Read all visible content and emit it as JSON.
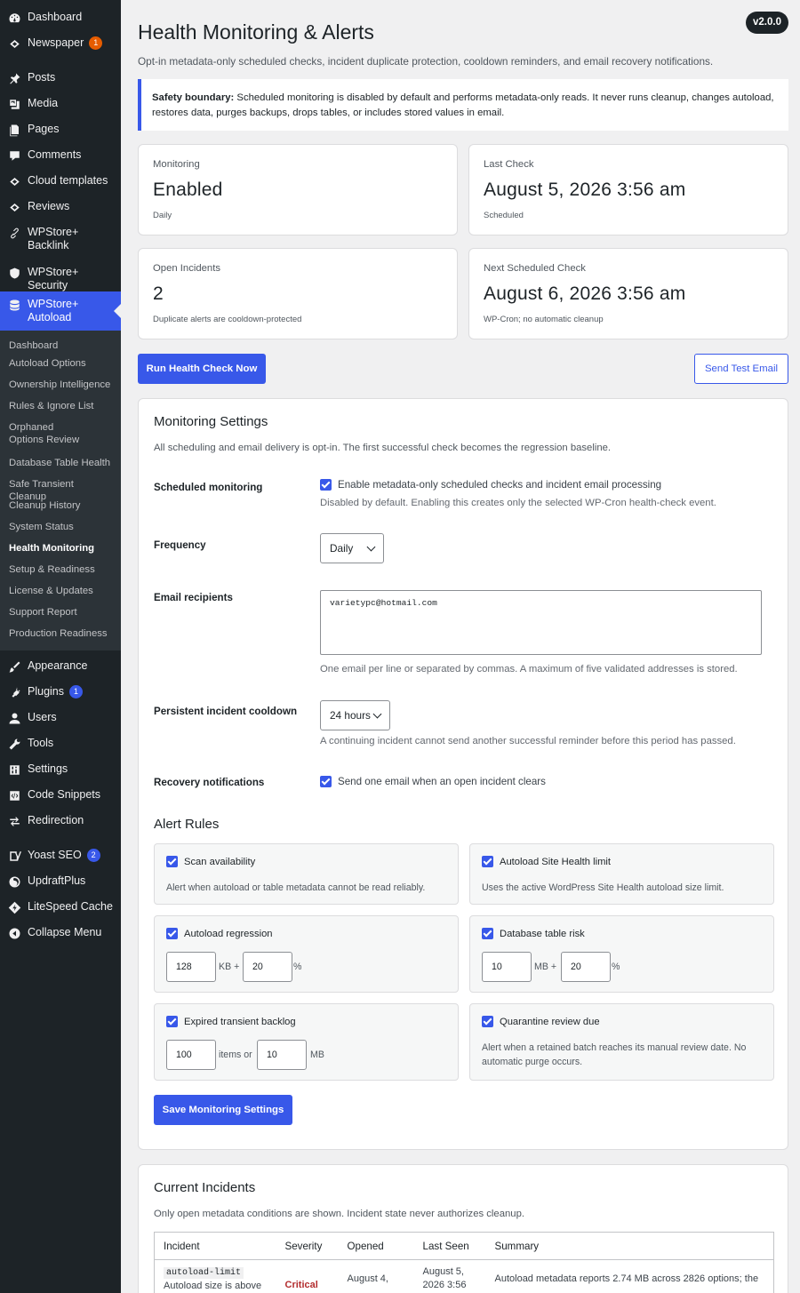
{
  "sidebar": {
    "top": [
      {
        "label": "Dashboard",
        "icon": "dashboard-icon"
      },
      {
        "label": "Newspaper",
        "icon": "newspaper-icon",
        "badge": "1"
      }
    ],
    "main": [
      {
        "label": "Posts",
        "icon": "pin-icon"
      },
      {
        "label": "Media",
        "icon": "media-icon"
      },
      {
        "label": "Pages",
        "icon": "pages-icon"
      },
      {
        "label": "Comments",
        "icon": "comment-icon"
      },
      {
        "label": "Cloud templates",
        "icon": "diamond-icon"
      },
      {
        "label": "Reviews",
        "icon": "diamond-icon"
      },
      {
        "label": "WPStore+ Backlink",
        "icon": "link-icon"
      },
      {
        "label": "WPStore+ Security",
        "icon": "shield-icon"
      },
      {
        "label": "WPStore+ Autoload",
        "icon": "database-icon"
      }
    ],
    "submenu": [
      "Dashboard",
      "Autoload Options",
      "Ownership Intelligence",
      "Rules & Ignore List",
      "Orphaned Options Review",
      "Database Table Health",
      "Safe Transient Cleanup",
      "Cleanup History",
      "System Status",
      "Health Monitoring",
      "Setup & Readiness",
      "License & Updates",
      "Support Report",
      "Production Readiness"
    ],
    "bottom": [
      {
        "label": "Appearance",
        "icon": "brush-icon"
      },
      {
        "label": "Plugins",
        "icon": "plug-icon",
        "badge": "1"
      },
      {
        "label": "Users",
        "icon": "user-icon"
      },
      {
        "label": "Tools",
        "icon": "wrench-icon"
      },
      {
        "label": "Settings",
        "icon": "settings-icon"
      },
      {
        "label": "Code Snippets",
        "icon": "code-icon"
      },
      {
        "label": "Redirection",
        "icon": "redirect-icon"
      }
    ],
    "extra": [
      {
        "label": "Yoast SEO",
        "icon": "yoast-icon",
        "badge": "2"
      },
      {
        "label": "UpdraftPlus",
        "icon": "updraft-icon"
      },
      {
        "label": "LiteSpeed Cache",
        "icon": "litespeed-icon"
      },
      {
        "label": "Collapse Menu",
        "icon": "collapse-icon"
      }
    ]
  },
  "header": {
    "title": "Health Monitoring & Alerts",
    "subtitle": "Opt-in metadata-only scheduled checks, incident duplicate protection, cooldown reminders, and email recovery notifications.",
    "version": "v2.0.0"
  },
  "notice": {
    "strong": "Safety boundary:",
    "text": " Scheduled monitoring is disabled by default and performs metadata-only reads. It never runs cleanup, changes autoload, restores data, purges backups, drops tables, or includes stored values in email."
  },
  "cards": [
    {
      "label": "Monitoring",
      "value": "Enabled",
      "note": "Daily"
    },
    {
      "label": "Last Check",
      "value": "August 5, 2026 3:56 am",
      "note": "Scheduled"
    },
    {
      "label": "Open Incidents",
      "value": "2",
      "note": "Duplicate alerts are cooldown-protected"
    },
    {
      "label": "Next Scheduled Check",
      "value": "August 6, 2026 3:56 am",
      "note": "WP-Cron; no automatic cleanup"
    }
  ],
  "actions": {
    "run": "Run Health Check Now",
    "test": "Send Test Email"
  },
  "settings": {
    "title": "Monitoring Settings",
    "desc": "All scheduling and email delivery is opt-in. The first successful check becomes the regression baseline.",
    "scheduled": {
      "label": "Scheduled monitoring",
      "check": "Enable metadata-only scheduled checks and incident email processing",
      "hint": "Disabled by default. Enabling this creates only the selected WP-Cron health-check event."
    },
    "frequency": {
      "label": "Frequency",
      "value": "Daily"
    },
    "email": {
      "label": "Email recipients",
      "value": "varietypc@hotmail.com",
      "hint": "One email per line or separated by commas. A maximum of five validated addresses is stored."
    },
    "cooldown": {
      "label": "Persistent incident cooldown",
      "value": "24 hours",
      "hint": "A continuing incident cannot send another successful reminder before this period has passed."
    },
    "recovery": {
      "label": "Recovery notifications",
      "check": "Send one email when an open incident clears"
    }
  },
  "alert_rules": {
    "title": "Alert Rules",
    "scan": {
      "label": "Scan availability",
      "desc": "Alert when autoload or table metadata cannot be read reliably."
    },
    "site_health": {
      "label": "Autoload Site Health limit",
      "desc": "Uses the active WordPress Site Health autoload size limit."
    },
    "regression": {
      "label": "Autoload regression",
      "kb": "128",
      "kb_unit": "KB +",
      "pct": "20",
      "pct_unit": "%"
    },
    "table_risk": {
      "label": "Database table risk",
      "mb": "10",
      "mb_unit": "MB +",
      "pct": "20",
      "pct_unit": "%"
    },
    "transient": {
      "label": "Expired transient backlog",
      "items": "100",
      "items_unit": "items or",
      "mb": "10",
      "mb_unit": "MB"
    },
    "quarantine": {
      "label": "Quarantine review due",
      "desc": "Alert when a retained batch reaches its manual review date. No automatic purge occurs."
    }
  },
  "save_label": "Save Monitoring Settings",
  "incidents": {
    "title": "Current Incidents",
    "desc": "Only open metadata conditions are shown. Incident state never authorizes cleanup.",
    "columns": [
      "Incident",
      "Severity",
      "Opened",
      "Last Seen",
      "Summary"
    ],
    "row": {
      "code": "autoload-limit",
      "name": "Autoload size is above",
      "severity": "Critical",
      "opened": "August 4,",
      "last_seen": "August 5, 2026 3:56",
      "summary": "Autoload metadata reports 2.74 MB across 2826 options; the"
    }
  }
}
